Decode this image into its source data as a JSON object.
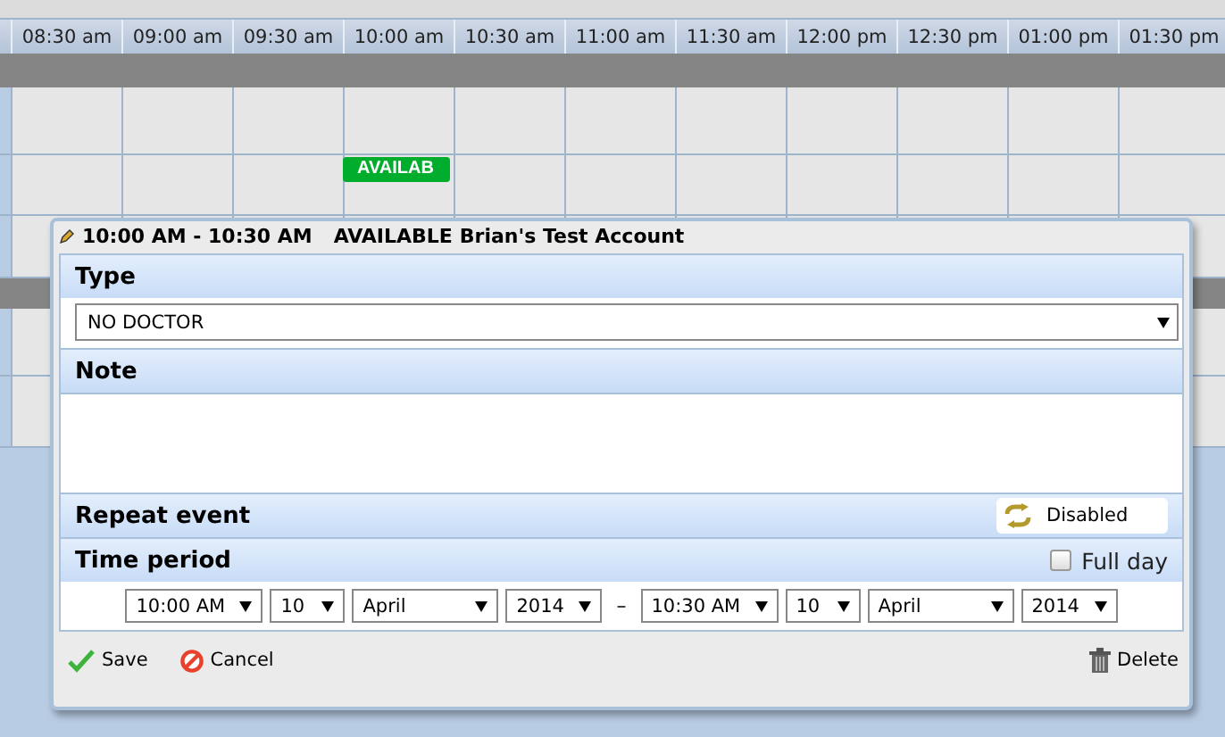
{
  "calendar": {
    "time_slots": [
      "08:30 am",
      "09:00 am",
      "09:30 am",
      "10:00 am",
      "10:30 am",
      "11:00 am",
      "11:30 am",
      "12:00 pm",
      "12:30 pm",
      "01:00 pm",
      "01:30 pm"
    ],
    "events": [
      {
        "label": "AVAILAB"
      }
    ]
  },
  "dialog": {
    "title_time": "10:00 AM - 10:30 AM",
    "title_status": "AVAILABLE",
    "title_account": "Brian's Test Account",
    "type": {
      "label": "Type",
      "value": "NO DOCTOR"
    },
    "note": {
      "label": "Note"
    },
    "repeat": {
      "label": "Repeat event",
      "value": "Disabled"
    },
    "time_period": {
      "label": "Time period",
      "full_day": {
        "label": "Full day",
        "checked": false
      },
      "start": [
        {
          "kind": "time",
          "value": "10:00 AM"
        },
        {
          "kind": "day",
          "value": "10"
        },
        {
          "kind": "month",
          "value": "April"
        },
        {
          "kind": "year",
          "value": "2014"
        }
      ],
      "separator": "–",
      "end": [
        {
          "kind": "time",
          "value": "10:30 AM"
        },
        {
          "kind": "day",
          "value": "10"
        },
        {
          "kind": "month",
          "value": "April"
        },
        {
          "kind": "year",
          "value": "2014"
        }
      ]
    },
    "actions": [
      {
        "kind": "save",
        "label": "Save"
      },
      {
        "kind": "cancel",
        "label": "Cancel"
      },
      {
        "kind": "delete",
        "label": "Delete"
      }
    ]
  }
}
